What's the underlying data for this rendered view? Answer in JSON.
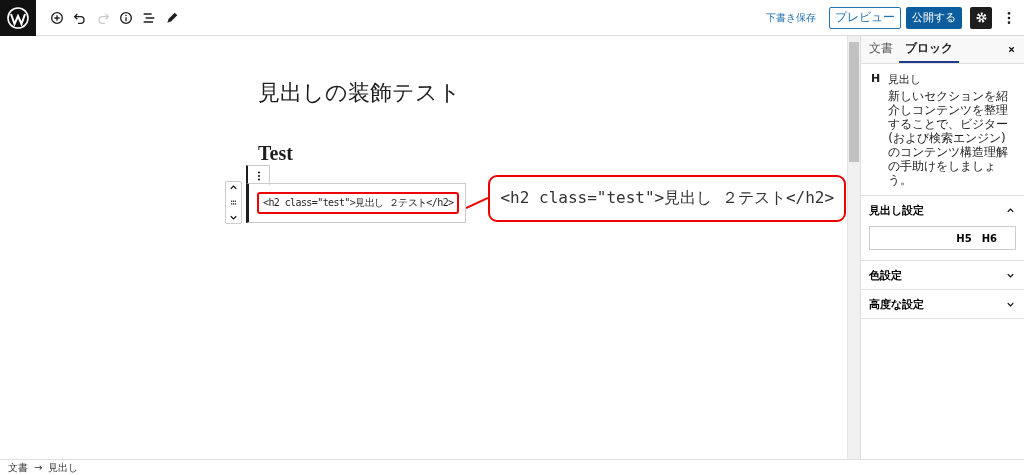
{
  "toolbar": {
    "save_draft": "下書き保存",
    "preview": "プレビュー",
    "publish": "公開する",
    "redo_disabled": true
  },
  "editor": {
    "post_title": "見出しの装飾テスト",
    "heading": "Test",
    "code_line": "<h2 class=\"test\">見出し ２テスト</h2>"
  },
  "callout": {
    "text": "<h2 class=\"test\">見出し ２テスト</h2>"
  },
  "sidebar": {
    "tabs": [
      {
        "label": "文書",
        "selected": false
      },
      {
        "label": "ブロック",
        "selected": true
      }
    ],
    "block": {
      "icon": "H",
      "name": "見出し",
      "description": "新しいセクションを紹介しコンテンツを整理することで、ビジター (および検索エンジン) のコンテンツ構造理解の手助けをしましょう。"
    },
    "panels": [
      {
        "title": "見出し設定",
        "expanded": true,
        "levels": [
          "H5",
          "H6"
        ]
      },
      {
        "title": "色設定",
        "expanded": false
      },
      {
        "title": "高度な設定",
        "expanded": false
      }
    ]
  },
  "breadcrumb": {
    "items": [
      "文書",
      "見出し"
    ],
    "separator": "→"
  }
}
